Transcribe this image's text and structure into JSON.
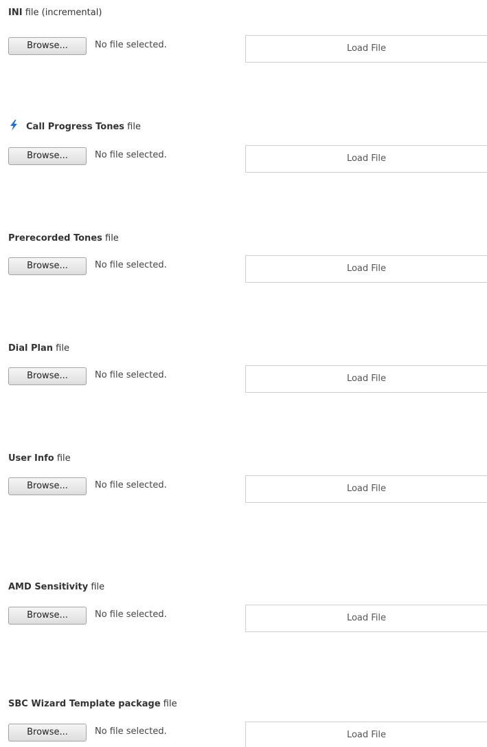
{
  "sections": [
    {
      "title_bold": "INI",
      "title_suffix": " file (incremental)",
      "browse_label": "Browse...",
      "file_status": "No file selected.",
      "load_label": "Load File"
    },
    {
      "title_bold": "Call Progress Tones",
      "title_suffix": " file",
      "icon": "lightning-bolt-icon",
      "icon_color": "#1f6fd1",
      "browse_label": "Browse...",
      "file_status": "No file selected.",
      "load_label": "Load File"
    },
    {
      "title_bold": "Prerecorded Tones",
      "title_suffix": " file",
      "browse_label": "Browse...",
      "file_status": "No file selected.",
      "load_label": "Load File"
    },
    {
      "title_bold": "Dial Plan",
      "title_suffix": " file",
      "browse_label": "Browse...",
      "file_status": "No file selected.",
      "load_label": "Load File"
    },
    {
      "title_bold": "User Info",
      "title_suffix": " file",
      "browse_label": "Browse...",
      "file_status": "No file selected.",
      "load_label": "Load File"
    },
    {
      "title_bold": "AMD Sensitivity",
      "title_suffix": " file",
      "browse_label": "Browse...",
      "file_status": "No file selected.",
      "load_label": "Load File"
    },
    {
      "title_bold": "SBC Wizard Template package",
      "title_suffix": " file",
      "browse_label": "Browse...",
      "file_status": "No file selected.",
      "load_label": "Load File"
    }
  ]
}
